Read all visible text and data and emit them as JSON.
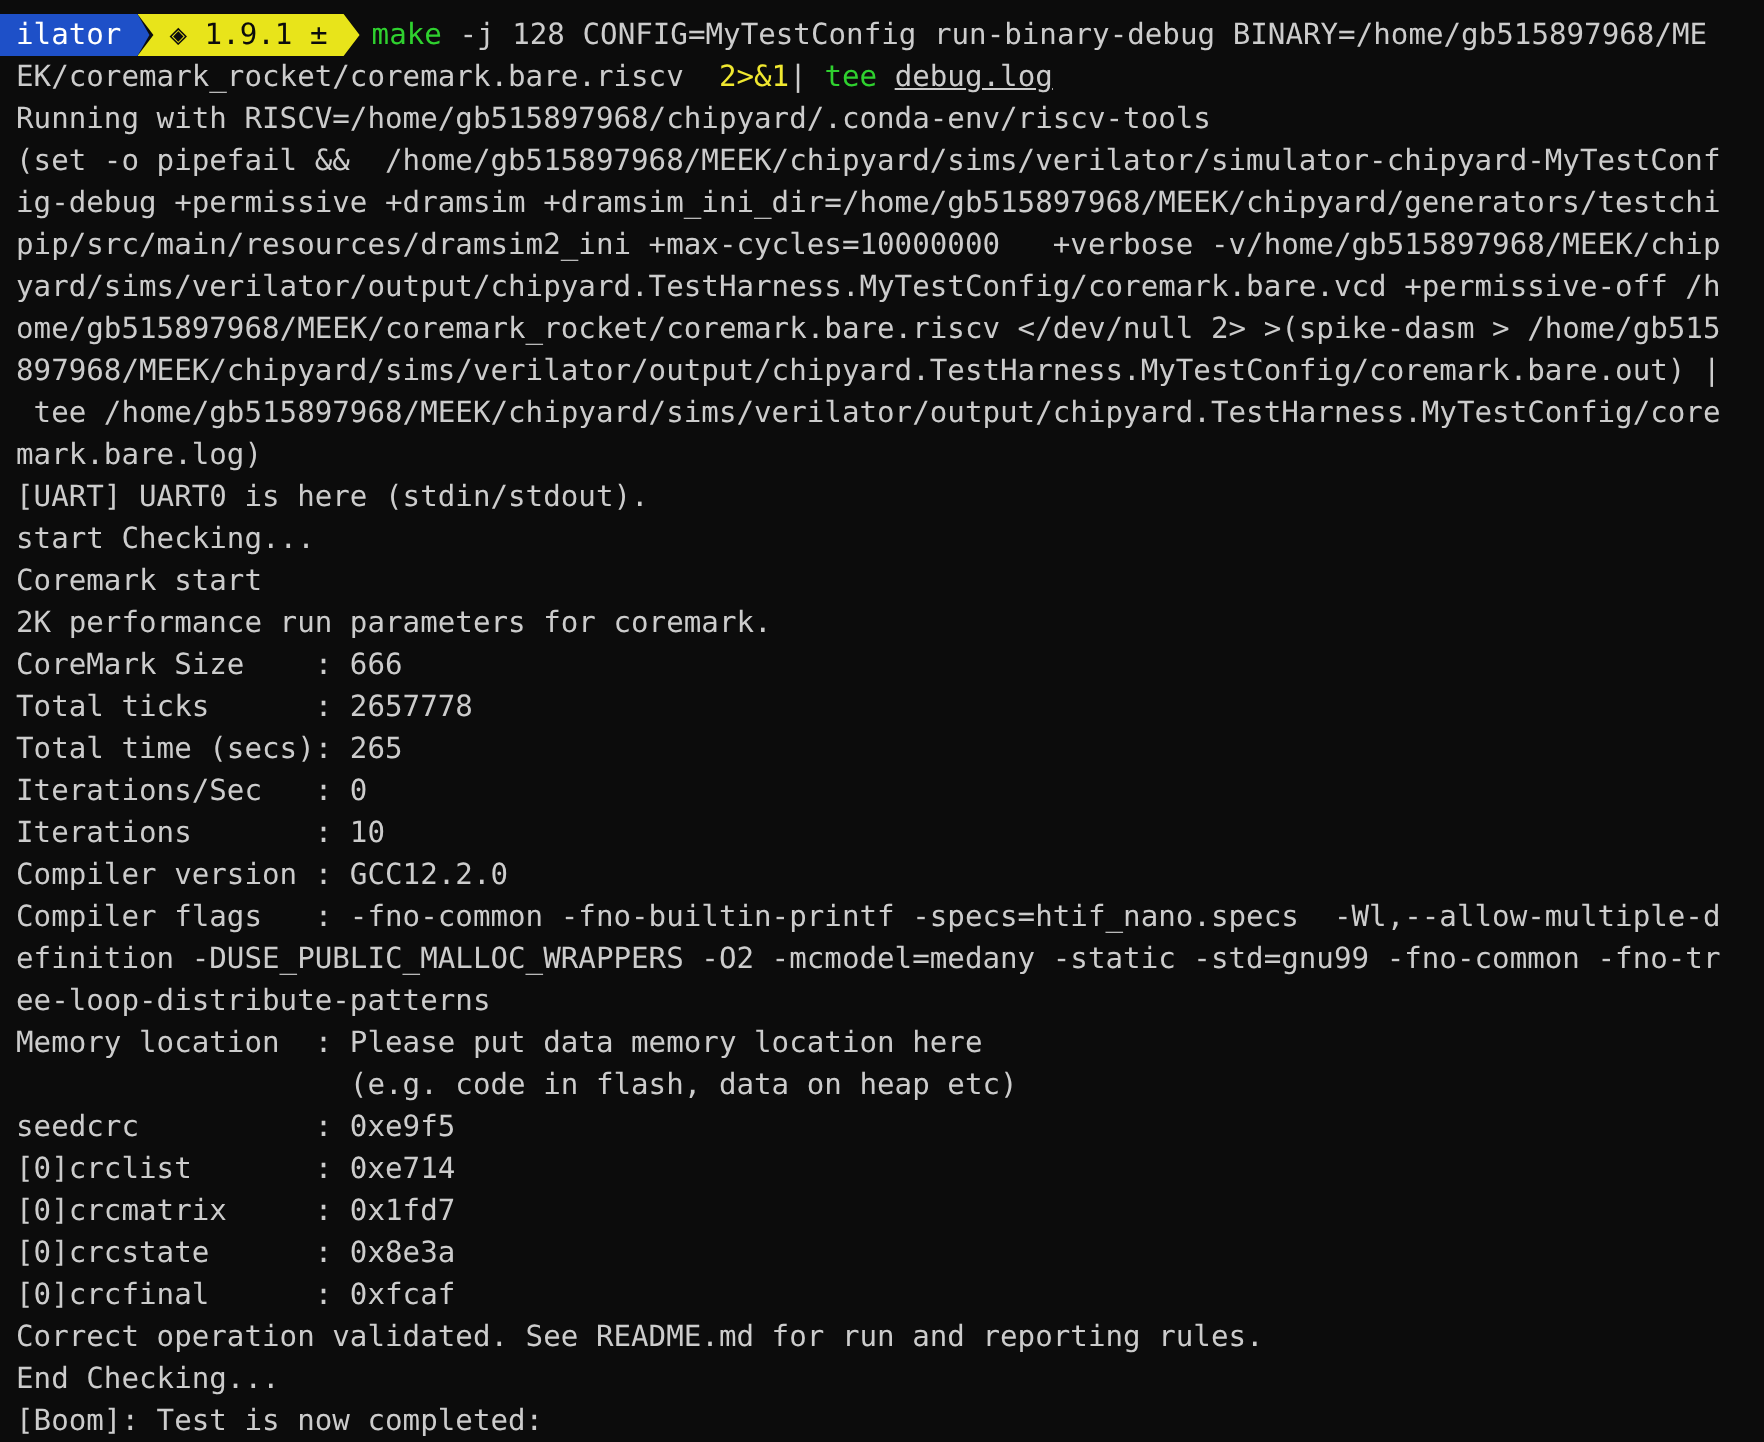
{
  "prompt": {
    "segments": [
      {
        "text": "ilator",
        "kind": "path"
      },
      {
        "text": "◈ 1.9.1 ±",
        "kind": "version"
      }
    ],
    "command": [
      {
        "text": "make",
        "kind": "cmd"
      },
      {
        "text": " -j 128 CONFIG=MyTestConfig run-binary-debug BINARY=/home/gb515897968/ME",
        "kind": "arg"
      }
    ]
  },
  "command_continuation": [
    {
      "text": "EK/coremark_rocket/coremark.bare.riscv  ",
      "kind": "arg"
    },
    {
      "text": "2>&1",
      "kind": "redirect"
    },
    {
      "text": "| ",
      "kind": "arg"
    },
    {
      "text": "tee",
      "kind": "cmd"
    },
    {
      "text": "debug.log",
      "kind": "file"
    }
  ],
  "output_lines": [
    "Running with RISCV=/home/gb515897968/chipyard/.conda-env/riscv-tools",
    "(set -o pipefail &&  /home/gb515897968/MEEK/chipyard/sims/verilator/simulator-chipyard-MyTestConf",
    "ig-debug +permissive +dramsim +dramsim_ini_dir=/home/gb515897968/MEEK/chipyard/generators/testchi",
    "pip/src/main/resources/dramsim2_ini +max-cycles=10000000   +verbose -v/home/gb515897968/MEEK/chip",
    "yard/sims/verilator/output/chipyard.TestHarness.MyTestConfig/coremark.bare.vcd +permissive-off /h",
    "ome/gb515897968/MEEK/coremark_rocket/coremark.bare.riscv </dev/null 2> >(spike-dasm > /home/gb515",
    "897968/MEEK/chipyard/sims/verilator/output/chipyard.TestHarness.MyTestConfig/coremark.bare.out) |",
    " tee /home/gb515897968/MEEK/chipyard/sims/verilator/output/chipyard.TestHarness.MyTestConfig/core",
    "mark.bare.log)",
    "[UART] UART0 is here (stdin/stdout).",
    "start Checking...",
    "Coremark start",
    "2K performance run parameters for coremark.",
    "CoreMark Size    : 666",
    "Total ticks      : 2657778",
    "Total time (secs): 265",
    "Iterations/Sec   : 0",
    "Iterations       : 10",
    "Compiler version : GCC12.2.0",
    "Compiler flags   : -fno-common -fno-builtin-printf -specs=htif_nano.specs  -Wl,--allow-multiple-d",
    "efinition -DUSE_PUBLIC_MALLOC_WRAPPERS -O2 -mcmodel=medany -static -std=gnu99 -fno-common -fno-tr",
    "ee-loop-distribute-patterns",
    "Memory location  : Please put data memory location here",
    "                   (e.g. code in flash, data on heap etc)",
    "seedcrc          : 0xe9f5",
    "[0]crclist       : 0xe714",
    "[0]crcmatrix     : 0x1fd7",
    "[0]crcstate      : 0x8e3a",
    "[0]crcfinal      : 0xfcaf",
    "Correct operation validated. See README.md for run and reporting rules.",
    "End Checking...",
    "[Boom]: Test is now completed:"
  ]
}
